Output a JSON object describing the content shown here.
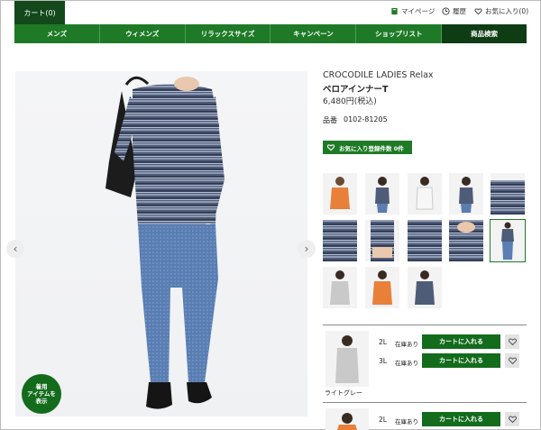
{
  "header": {
    "cart_tab": "カート(0)",
    "mypage": "マイページ",
    "history": "履歴",
    "favorites": "お気に入り(0)"
  },
  "nav": {
    "items": [
      "メンズ",
      "ウィメンズ",
      "リラックスサイズ",
      "キャンペーン",
      "ショップリスト",
      "商品検索"
    ]
  },
  "gallery": {
    "prev": "‹",
    "next": "›",
    "wear_badge": "着用\nアイテムを\n表示"
  },
  "product": {
    "brand": "CROCODILE LADIES Relax",
    "name": "ベロアインナーT",
    "price": "6,480円(税込)",
    "sku_label": "品番",
    "sku": "0102-81205",
    "fav_button": "お気に入り登録件数 0件"
  },
  "stock": {
    "color_name": "ライトグレー",
    "rows": [
      {
        "size": "2L",
        "status": "在庫あり",
        "button": "カートに入れる"
      },
      {
        "size": "3L",
        "status": "在庫あり",
        "button": "カートに入れる"
      },
      {
        "size": "2L",
        "status": "在庫あり",
        "button": "カートに入れる"
      }
    ]
  },
  "colors": {
    "brand_green": "#1e7a26",
    "dark_green": "#136b1c"
  }
}
